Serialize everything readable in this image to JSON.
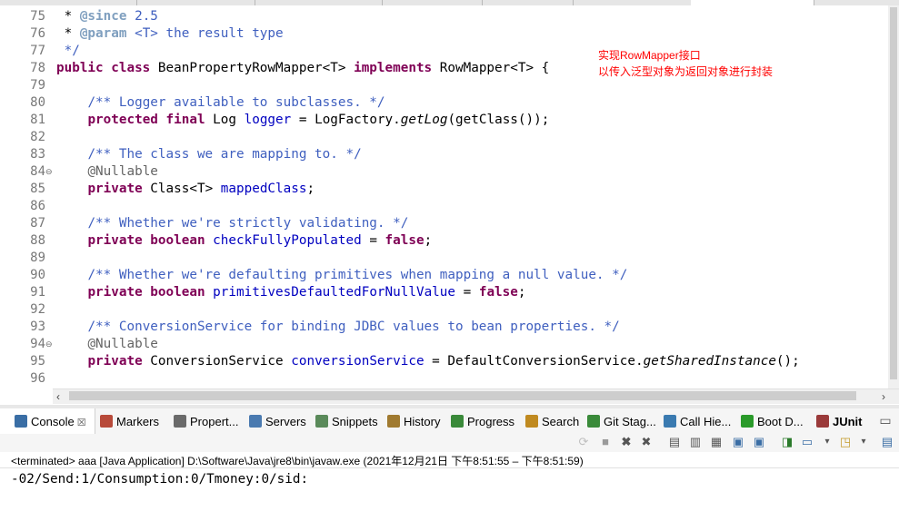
{
  "editor": {
    "lines": [
      {
        "num": "75",
        "fold": "",
        "html": " * <span class='jdt'>@since</span><span class='jd'> 2.5</span>",
        "raw": " * @since 2.5"
      },
      {
        "num": "76",
        "fold": "",
        "html": " * <span class='jdt'>@param</span><span class='jd'> &lt;T&gt; the result type</span>",
        "raw": " * @param <T> the result type"
      },
      {
        "num": "77",
        "fold": "",
        "html": "<span class='jd'> */</span>",
        "raw": " */"
      },
      {
        "num": "78",
        "fold": "",
        "html": "<span class='kw'>public class</span> BeanPropertyRowMapper&lt;T&gt; <span class='kw'>implements</span> RowMapper&lt;T&gt; {",
        "raw": "public class BeanPropertyRowMapper<T> implements RowMapper<T> {"
      },
      {
        "num": "79",
        "fold": "",
        "html": "",
        "raw": ""
      },
      {
        "num": "80",
        "fold": "",
        "html": "    <span class='jd'>/** Logger available to subclasses. */</span>",
        "raw": "    /** Logger available to subclasses. */"
      },
      {
        "num": "81",
        "fold": "",
        "html": "    <span class='kw'>protected final</span> Log <span class='fld'>logger</span> = LogFactory.<span class='ital'>getLog</span>(getClass());",
        "raw": "    protected final Log logger = LogFactory.getLog(getClass());"
      },
      {
        "num": "82",
        "fold": "",
        "html": "",
        "raw": ""
      },
      {
        "num": "83",
        "fold": "",
        "html": "    <span class='jd'>/** The class we are mapping to. */</span>",
        "raw": "    /** The class we are mapping to. */"
      },
      {
        "num": "84",
        "fold": "⊖",
        "html": "    <span class='ann'>@Nullable</span>",
        "raw": "    @Nullable"
      },
      {
        "num": "85",
        "fold": "",
        "html": "    <span class='kw'>private</span> Class&lt;T&gt; <span class='fld'>mappedClass</span>;",
        "raw": "    private Class<T> mappedClass;"
      },
      {
        "num": "86",
        "fold": "",
        "html": "",
        "raw": ""
      },
      {
        "num": "87",
        "fold": "",
        "html": "    <span class='jd'>/** Whether we're strictly validating. */</span>",
        "raw": "    /** Whether we're strictly validating. */"
      },
      {
        "num": "88",
        "fold": "",
        "html": "    <span class='kw'>private boolean</span> <span class='fld'>checkFullyPopulated</span> = <span class='kw'>false</span>;",
        "raw": "    private boolean checkFullyPopulated = false;"
      },
      {
        "num": "89",
        "fold": "",
        "html": "",
        "raw": ""
      },
      {
        "num": "90",
        "fold": "",
        "html": "    <span class='jd'>/** Whether we're defaulting primitives when mapping a null value. */</span>",
        "raw": "    /** Whether we're defaulting primitives when mapping a null value. */"
      },
      {
        "num": "91",
        "fold": "",
        "html": "    <span class='kw'>private boolean</span> <span class='fld'>primitivesDefaultedForNullValue</span> = <span class='kw'>false</span>;",
        "raw": "    private boolean primitivesDefaultedForNullValue = false;"
      },
      {
        "num": "92",
        "fold": "",
        "html": "",
        "raw": ""
      },
      {
        "num": "93",
        "fold": "",
        "html": "    <span class='jd'>/** ConversionService for binding JDBC values to bean properties. */</span>",
        "raw": "    /** ConversionService for binding JDBC values to bean properties. */"
      },
      {
        "num": "94",
        "fold": "⊖",
        "html": "    <span class='ann'>@Nullable</span>",
        "raw": "    @Nullable"
      },
      {
        "num": "95",
        "fold": "",
        "html": "    <span class='kw'>private</span> ConversionService <span class='fld'>conversionService</span> = DefaultConversionService.<span class='ital'>getSharedInstance</span>();",
        "raw": "    private ConversionService conversionService = DefaultConversionService.getSharedInstance();"
      },
      {
        "num": "96",
        "fold": "",
        "html": "",
        "raw": ""
      }
    ],
    "annotation_line1": "实现RowMapper接口",
    "annotation_line2": "以传入泛型对象为返回对象进行封装"
  },
  "views": {
    "tabs": [
      {
        "label": "Console",
        "icon": "console-icon",
        "closable": true
      },
      {
        "label": "Markers",
        "icon": "markers-icon"
      },
      {
        "label": "Propert...",
        "icon": "properties-icon"
      },
      {
        "label": "Servers",
        "icon": "servers-icon"
      },
      {
        "label": "Snippets",
        "icon": "snippets-icon"
      },
      {
        "label": "History",
        "icon": "history-icon"
      },
      {
        "label": "Progress",
        "icon": "progress-icon"
      },
      {
        "label": "Search",
        "icon": "search-icon"
      },
      {
        "label": "Git Stag...",
        "icon": "git-staging-icon"
      },
      {
        "label": "Call Hie...",
        "icon": "call-hierarchy-icon"
      },
      {
        "label": "Boot D...",
        "icon": "boot-dashboard-icon"
      },
      {
        "label": "JUnit",
        "icon": "junit-icon"
      }
    ],
    "close_glyph": "☒"
  },
  "console": {
    "status": "<terminated> aaa [Java Application] D:\\Software\\Java\\jre8\\bin\\javaw.exe  (2021年12月21日 下午8:51:55 – 下午8:51:59)",
    "output": "-02/Send:1/Consumption:0/Tmoney:0/sid:"
  },
  "colors": {
    "keyword": "#7f0055",
    "javadoc": "#3f5fbf",
    "field": "#0000c0",
    "annotation_note": "#ff0000"
  }
}
